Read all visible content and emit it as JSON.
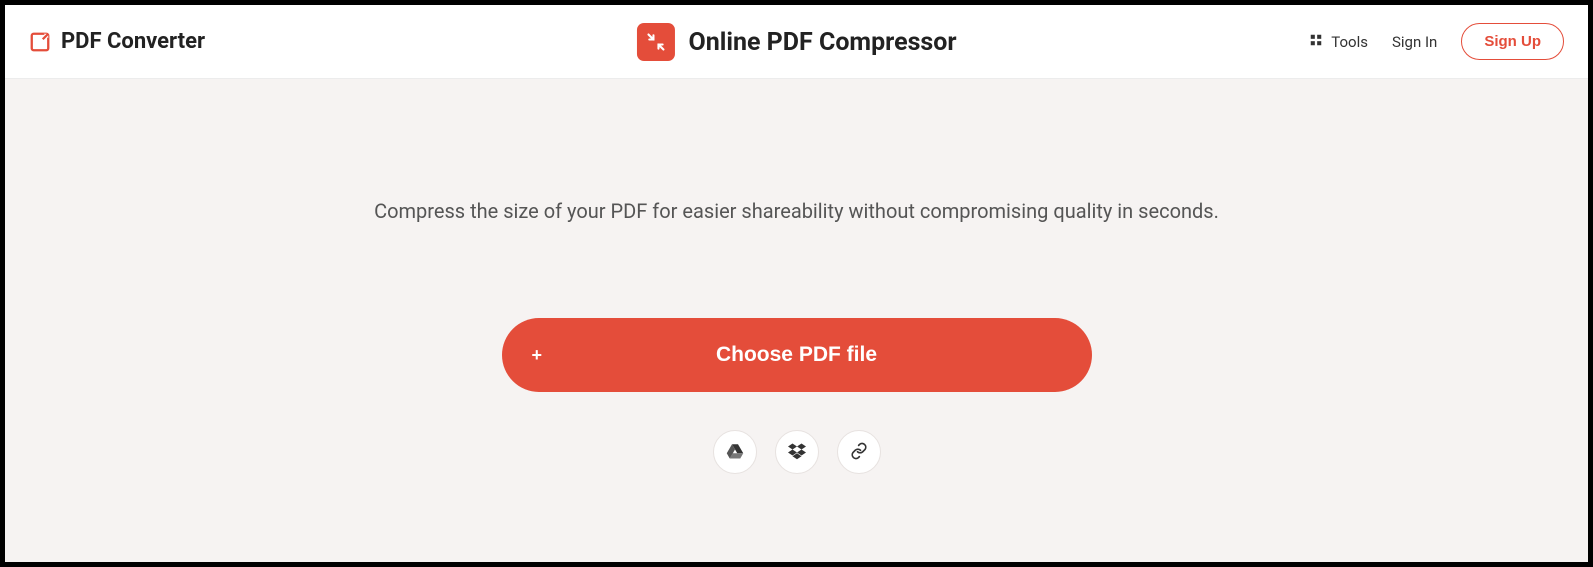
{
  "brand": {
    "name": "PDF Converter"
  },
  "header": {
    "title": "Online PDF Compressor",
    "nav": {
      "tools": "Tools",
      "signin": "Sign In",
      "signup": "Sign Up"
    }
  },
  "main": {
    "subtitle": "Compress the size of your PDF for easier shareability without compromising quality in seconds.",
    "choose_label": "Choose PDF file",
    "plus": "+"
  }
}
